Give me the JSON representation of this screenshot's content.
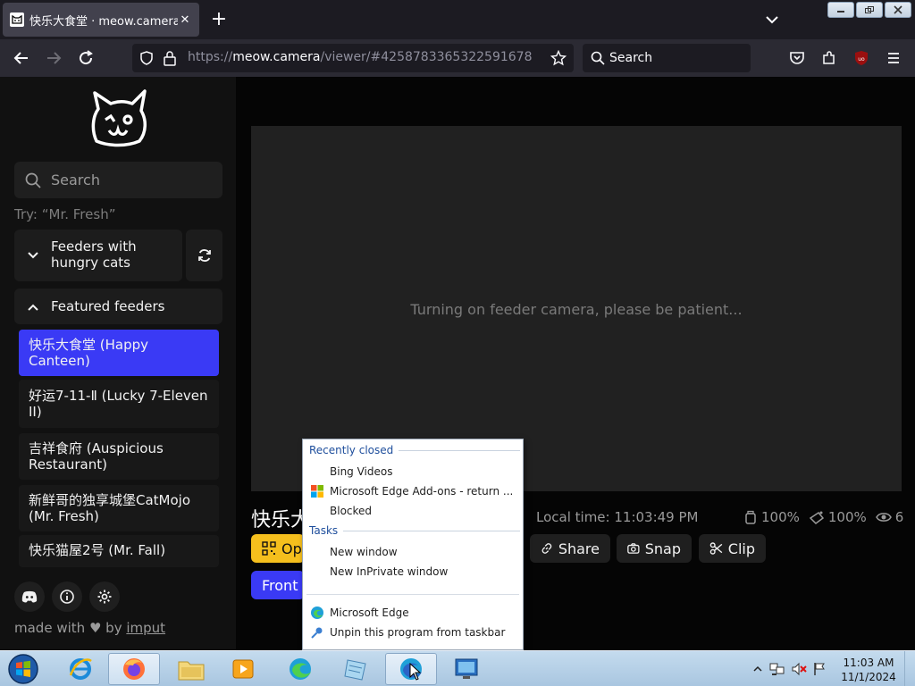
{
  "browser": {
    "tab_title": "快乐大食堂 · meow.camera",
    "url_prefix": "https://",
    "url_host": "meow.camera",
    "url_path": "/viewer/#4258783365322591678",
    "search_placeholder": "Search"
  },
  "sidebar": {
    "search_placeholder": "Search",
    "hint": "Try: “Mr. Fresh”",
    "group_hungry": "Feeders with hungry cats",
    "group_featured": "Featured feeders",
    "feeders": [
      {
        "label": "快乐大食堂 (Happy Canteen)",
        "active": true
      },
      {
        "label": "好运7-11-Ⅱ (Lucky 7-Eleven II)",
        "active": false
      },
      {
        "label": "吉祥食府 (Auspicious Restaurant)",
        "active": false
      },
      {
        "label": "新鲜哥的独享城堡CatMojo (Mr. Fresh)",
        "active": false
      },
      {
        "label": "快乐猫屋2号 (Mr. Fall)",
        "active": false
      }
    ],
    "made_with_prefix": "made with",
    "made_with_by": "by",
    "made_with_author": "imput"
  },
  "viewer": {
    "loading_message": "Turning on feeder camera, please be patient...",
    "title_visible": "快乐大",
    "local_time": "Local time: 11:03:49 PM",
    "food_level": "100%",
    "water_level": "100%",
    "viewers": "6",
    "open_label": "Op",
    "share_label": "Share",
    "snap_label": "Snap",
    "clip_label": "Clip",
    "front_label": "Front"
  },
  "jumplist": {
    "recent_header": "Recently closed",
    "recent_items": [
      "Bing Videos",
      "Microsoft Edge Add-ons - return ...",
      "Blocked"
    ],
    "tasks_header": "Tasks",
    "task_items": [
      "New window",
      "New InPrivate window"
    ],
    "app_items": [
      "Microsoft Edge",
      "Unpin this program from taskbar"
    ]
  },
  "taskbar": {
    "time": "11:03 AM",
    "date": "11/1/2024"
  },
  "colors": {
    "accent_blue": "#3a3af5",
    "accent_yellow": "#f5bf1d",
    "page_bg": "#050505"
  }
}
